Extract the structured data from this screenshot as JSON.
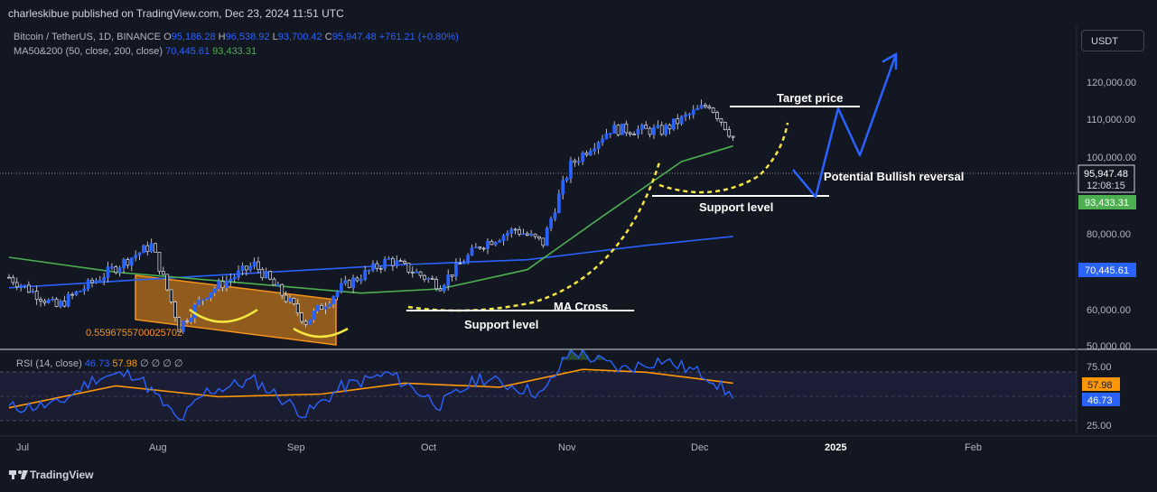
{
  "header": {
    "published": "charleskibue published on TradingView.com, Dec 23, 2024 11:51 UTC"
  },
  "legend": {
    "symbol": "Bitcoin / TetherUS, 1D, BINANCE",
    "o_label": "O",
    "o": "95,186.28",
    "h_label": "H",
    "h": "96,538.92",
    "l_label": "L",
    "l": "93,700.42",
    "c_label": "C",
    "c": "95,947.48",
    "change": "+761.21 (+0.80%)",
    "ma_label": "MA50&200 (50, close, 200, close)",
    "ma50": "70,445.61",
    "ma200": "93,433.31",
    "rsi_label": "RSI (14, close)",
    "rsi": "46.73",
    "rsi_ma": "57.98",
    "rsi_extra": "∅ ∅ ∅ ∅"
  },
  "currency": "USDT",
  "footer": {
    "brand": "TradingView"
  },
  "colors": {
    "bg": "#131722",
    "bull": "#2962ff",
    "ma50": "#4caf50",
    "ma200": "#2962ff",
    "annot_yellow": "#f5e642",
    "channel": "#f7931a",
    "rsi_line": "#2962ff",
    "rsi_ma": "#ff9800"
  },
  "chart_data": [
    {
      "type": "line",
      "panel": "price",
      "title": "Bitcoin / TetherUS, 1D, BINANCE",
      "x_ticks": [
        "Jul",
        "Aug",
        "Sep",
        "Oct",
        "Nov",
        "Dec",
        "2025",
        "Feb"
      ],
      "y_ticks": [
        "120,000.00",
        "110,000.00",
        "100,000.00",
        "80,000.00",
        "60,000.00",
        "50,000.00"
      ],
      "y_tick_values": [
        120000,
        110000,
        100000,
        80000,
        60000,
        50000
      ],
      "y_axis": {
        "scale": "log",
        "range": [
          49500,
          137000
        ]
      },
      "x_axis": {
        "start": "2024-06-23",
        "end": "2025-02-20"
      },
      "grid": false,
      "price_labels": [
        {
          "text": "95,947.48",
          "timer": "12:08:15",
          "value": 95947.48,
          "color": "#131722"
        },
        {
          "text": "93,433.31",
          "value": 93433.31,
          "color": "#4caf50"
        },
        {
          "text": "70,445.61",
          "value": 70445.61,
          "color": "#2962ff"
        }
      ],
      "series": [
        {
          "name": "Bitcoin / TetherUS",
          "kind": "close",
          "x": [
            "2024-06-23",
            "2024-07-05",
            "2024-07-15",
            "2024-07-29",
            "2024-08-05",
            "2024-08-12",
            "2024-08-24",
            "2024-09-06",
            "2024-09-15",
            "2024-09-27",
            "2024-10-10",
            "2024-10-20",
            "2024-10-29",
            "2024-11-05",
            "2024-11-12",
            "2024-11-22",
            "2024-12-05",
            "2024-12-17",
            "2024-12-23"
          ],
          "values": [
            62000,
            56500,
            61500,
            68500,
            53000,
            59000,
            64500,
            54000,
            60000,
            65500,
            60500,
            68500,
            72000,
            69000,
            88000,
            98500,
            98000,
            106500,
            95947
          ]
        },
        {
          "name": "MA 50",
          "x": [
            "2024-06-23",
            "2024-07-20",
            "2024-08-20",
            "2024-09-20",
            "2024-10-10",
            "2024-11-01",
            "2024-11-20",
            "2024-12-10",
            "2024-12-23"
          ],
          "values": [
            66000,
            63000,
            61000,
            59000,
            59800,
            63500,
            75000,
            89000,
            93433
          ]
        },
        {
          "name": "MA 200",
          "x": [
            "2024-06-23",
            "2024-08-01",
            "2024-09-01",
            "2024-10-01",
            "2024-11-01",
            "2024-12-01",
            "2024-12-23"
          ],
          "values": [
            60000,
            61800,
            63200,
            64500,
            65500,
            68500,
            70446
          ]
        }
      ],
      "annotations": [
        {
          "text": "Target price"
        },
        {
          "text": "Potential Bullish reversal"
        },
        {
          "text": "Support level"
        },
        {
          "text": "MA Cross"
        },
        {
          "text": "Support level"
        },
        {
          "text": "0.5596755700025702"
        }
      ]
    },
    {
      "type": "line",
      "panel": "rsi",
      "title": "RSI (14, close)",
      "y_ticks": [
        "75.00",
        "25.00"
      ],
      "y_tick_values": [
        75,
        25
      ],
      "y_axis": {
        "range": [
          20,
          82
        ]
      },
      "value_labels": [
        {
          "text": "57.98",
          "value": 57.98,
          "color": "#ff9800"
        },
        {
          "text": "46.73",
          "value": 46.73,
          "color": "#2962ff"
        }
      ],
      "series": [
        {
          "name": "RSI",
          "x": [
            "2024-06-23",
            "2024-07-05",
            "2024-07-15",
            "2024-07-25",
            "2024-08-05",
            "2024-08-12",
            "2024-08-24",
            "2024-09-06",
            "2024-09-15",
            "2024-09-27",
            "2024-10-10",
            "2024-10-20",
            "2024-11-05",
            "2024-11-12",
            "2024-11-25",
            "2024-12-05",
            "2024-12-17",
            "2024-12-23"
          ],
          "values": [
            40,
            42,
            62,
            65,
            30,
            52,
            60,
            35,
            55,
            65,
            42,
            62,
            50,
            82,
            68,
            75,
            63,
            46.73
          ]
        },
        {
          "name": "RSI MA",
          "x": [
            "2024-06-23",
            "2024-07-20",
            "2024-08-15",
            "2024-09-10",
            "2024-10-01",
            "2024-10-25",
            "2024-11-15",
            "2024-12-01",
            "2024-12-23"
          ],
          "values": [
            40,
            56,
            48,
            50,
            58,
            55,
            68,
            66,
            57.98
          ]
        }
      ]
    }
  ]
}
